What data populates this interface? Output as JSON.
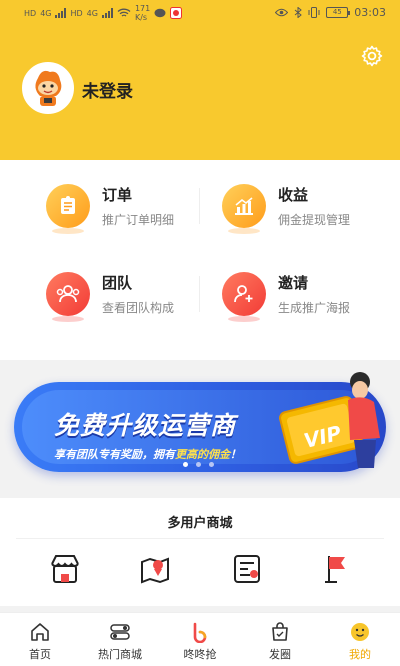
{
  "status_bar": {
    "sim1": "HD",
    "net1": "4G",
    "sim2": "HD",
    "net2": "4G",
    "speed_value": "171",
    "speed_unit": "K/s",
    "battery": "45",
    "time": "03:03"
  },
  "header": {
    "login_label": "未登录"
  },
  "menu": [
    {
      "title": "订单",
      "subtitle": "推广订单明细",
      "icon": "order-icon",
      "color": "#ff9c1a"
    },
    {
      "title": "收益",
      "subtitle": "佣金提现管理",
      "icon": "earnings-icon",
      "color": "#ff9c1a"
    },
    {
      "title": "团队",
      "subtitle": "查看团队构成",
      "icon": "team-icon",
      "color": "#f23b36"
    },
    {
      "title": "邀请",
      "subtitle": "生成推广海报",
      "icon": "invite-icon",
      "color": "#f23b36"
    }
  ],
  "banner": {
    "title": "免费升级运营商",
    "subtitle_part1": "享有团队专有奖励，拥有",
    "subtitle_highlight": "更高的佣金",
    "subtitle_part2": "！",
    "badge": "VIP"
  },
  "mall": {
    "title": "多用户商城",
    "icons": [
      "shop-icon",
      "location-icon",
      "list-icon",
      "flag-icon"
    ]
  },
  "tabbar": {
    "items": [
      {
        "label": "首页",
        "icon": "home-icon"
      },
      {
        "label": "热门商城",
        "icon": "toggle-icon"
      },
      {
        "label": "咚咚抢",
        "icon": "b-logo-icon"
      },
      {
        "label": "发圈",
        "icon": "bag-icon"
      },
      {
        "label": "我的",
        "icon": "smile-icon"
      }
    ],
    "active_index": 4
  },
  "colors": {
    "brand_yellow": "#f8c92e",
    "accent_orange": "#f0a800",
    "banner_blue": "#2f5fe2"
  }
}
